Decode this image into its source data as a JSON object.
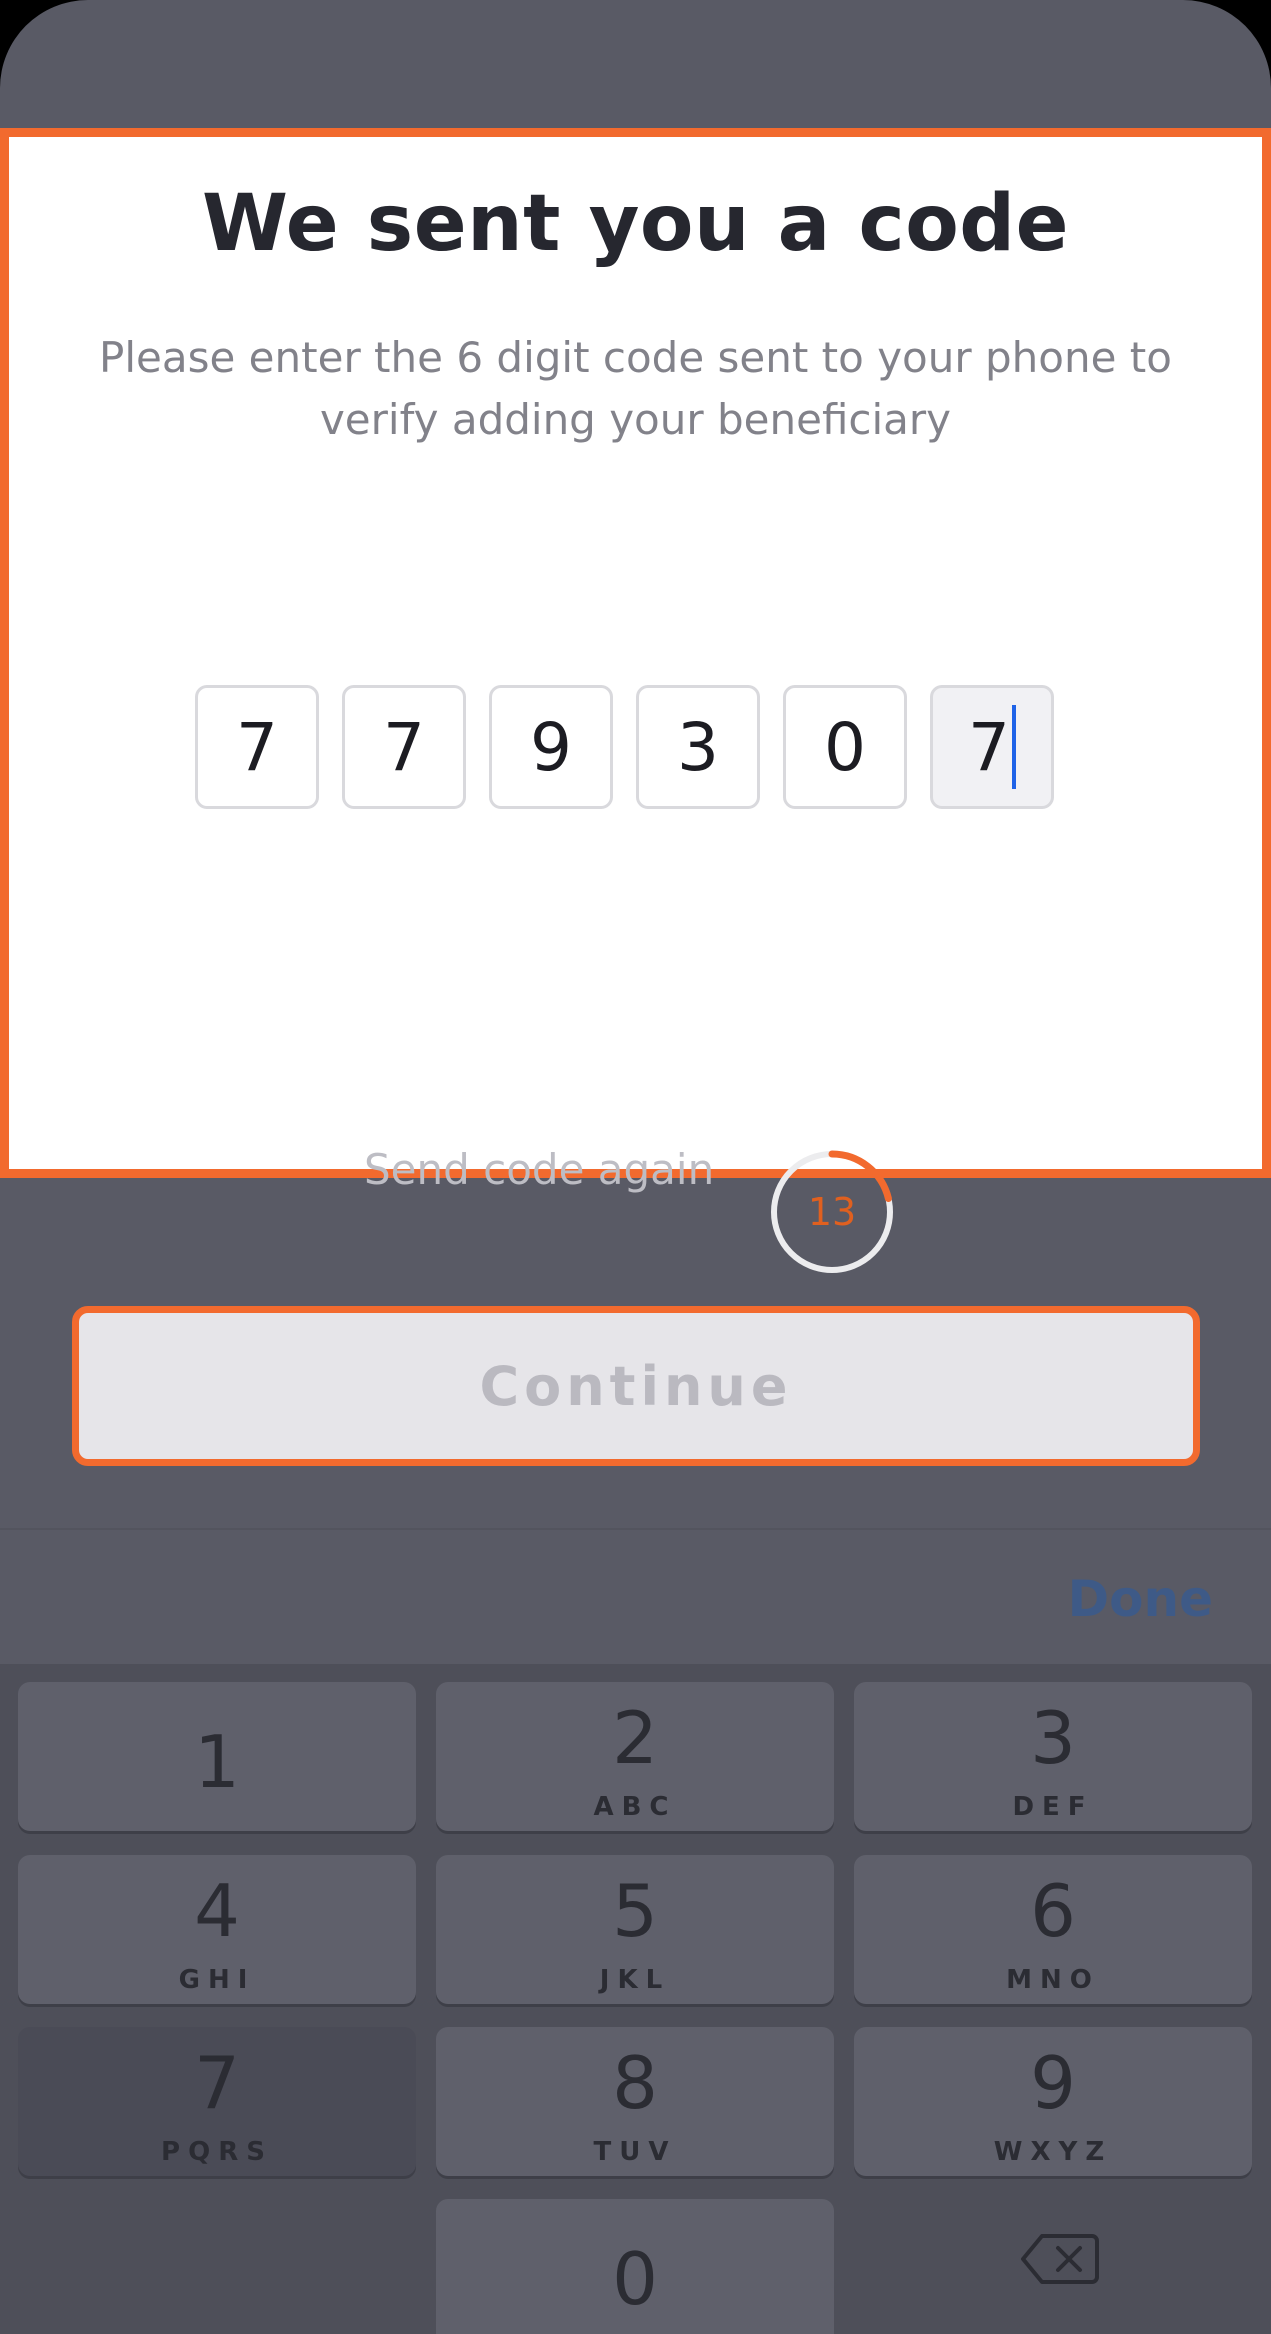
{
  "verify": {
    "title": "We sent you a code",
    "subtitle": "Please enter the 6 digit code sent to your phone to verify adding your beneficiary",
    "code_digits": [
      "7",
      "7",
      "9",
      "3",
      "0",
      "7"
    ],
    "resend_label": "Send code again",
    "timer_seconds": "13"
  },
  "actions": {
    "continue_label": "Continue"
  },
  "keyboard": {
    "done_label": "Done",
    "keys": [
      {
        "num": "1",
        "letters": ""
      },
      {
        "num": "2",
        "letters": "ABC"
      },
      {
        "num": "3",
        "letters": "DEF"
      },
      {
        "num": "4",
        "letters": "GHI"
      },
      {
        "num": "5",
        "letters": "JKL"
      },
      {
        "num": "6",
        "letters": "MNO"
      },
      {
        "num": "7",
        "letters": "PQRS"
      },
      {
        "num": "8",
        "letters": "TUV"
      },
      {
        "num": "9",
        "letters": "WXYZ"
      },
      {
        "num": "0",
        "letters": ""
      }
    ],
    "backspace_icon": "backspace-icon"
  },
  "colors": {
    "accent": "#f26a2e",
    "caret": "#1f63e8",
    "done": "#3e5a87",
    "overlay": "#595a65"
  }
}
